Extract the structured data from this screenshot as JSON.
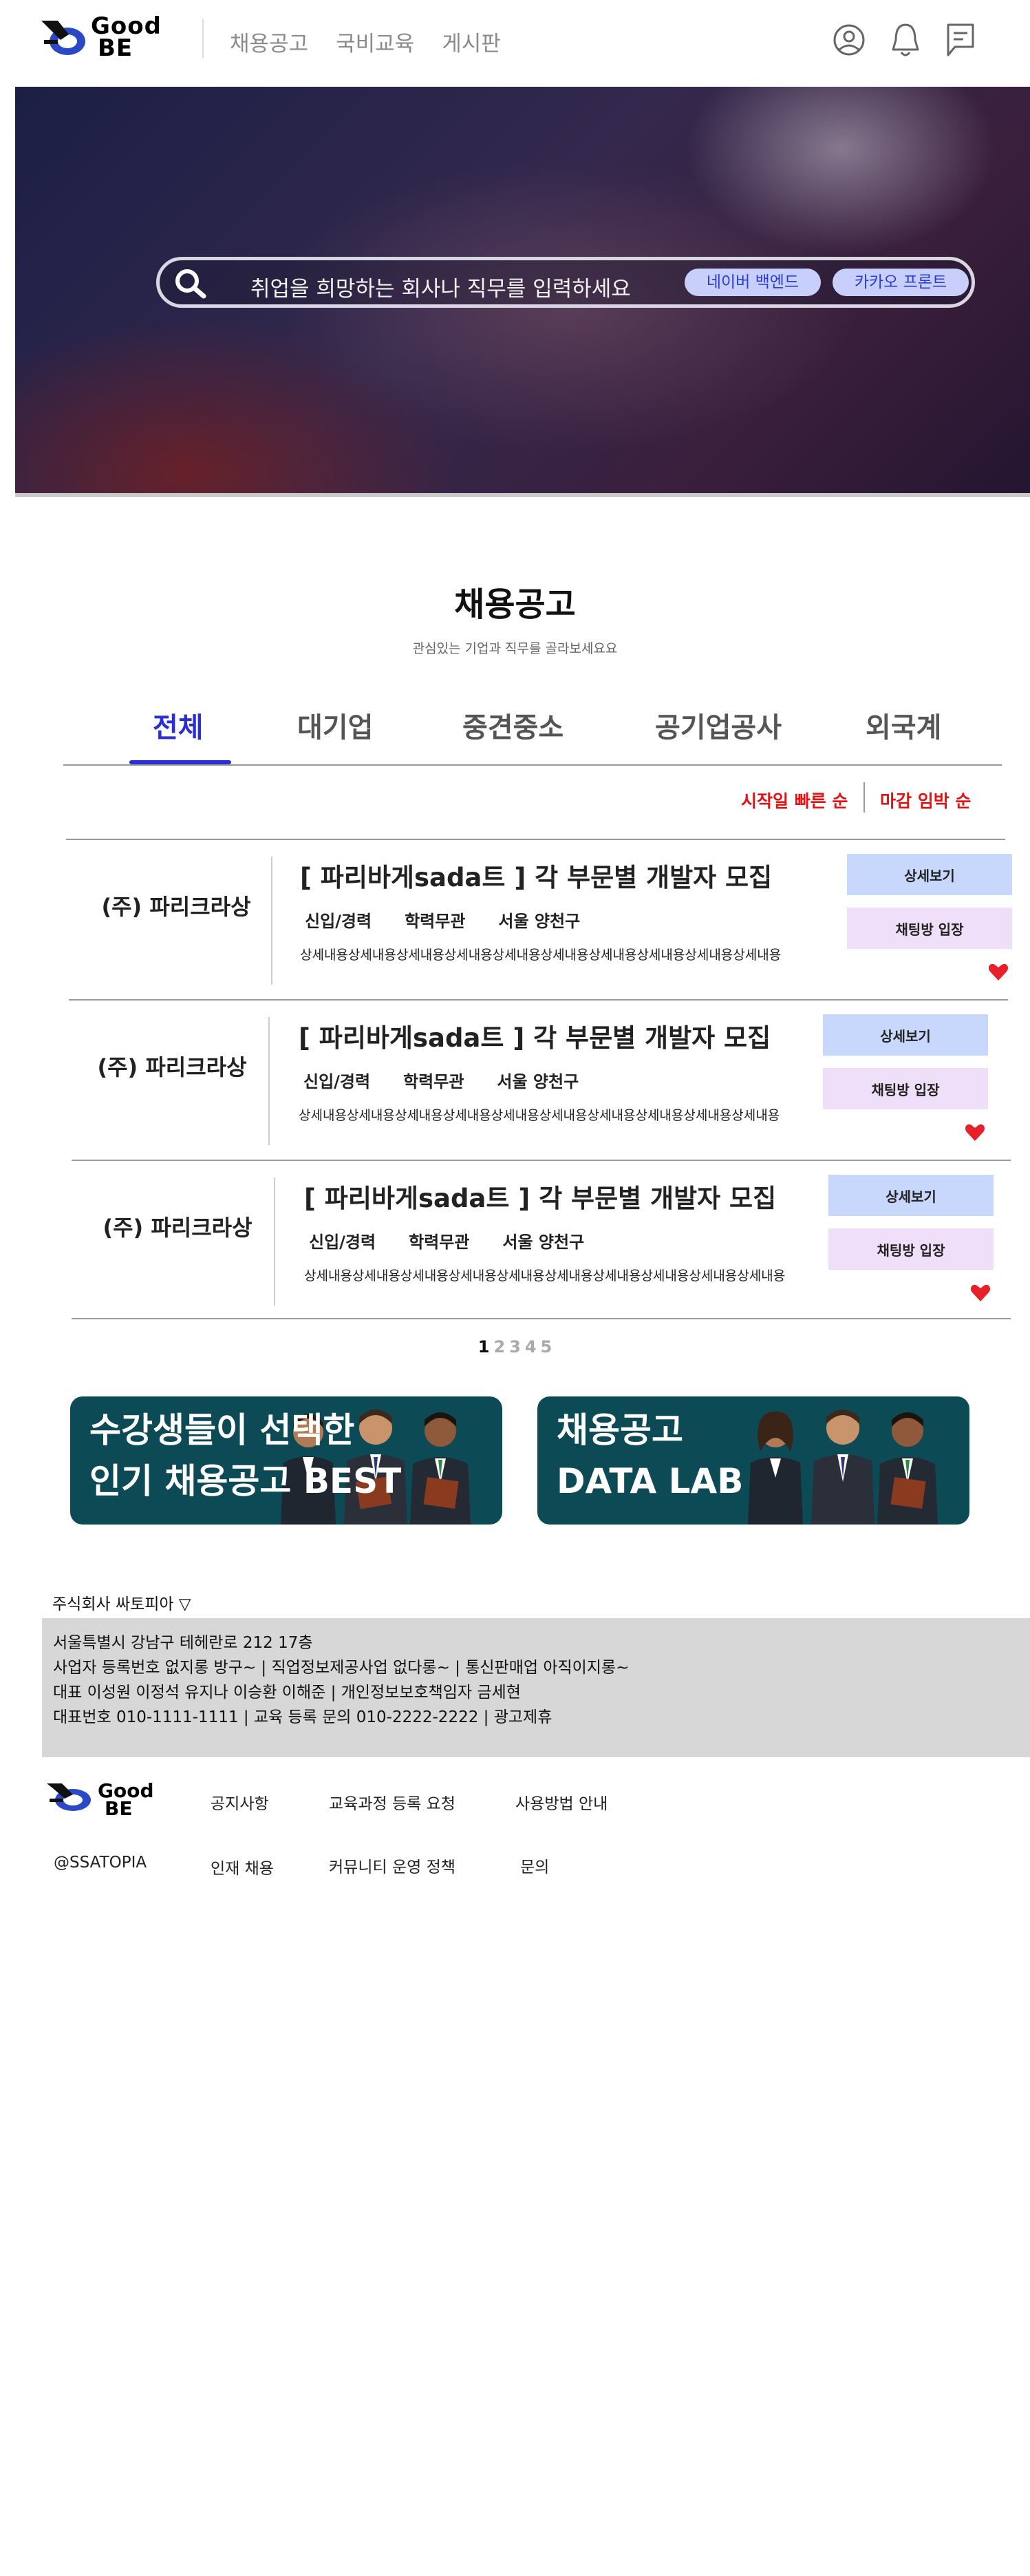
{
  "header": {
    "logo_text_line1": "Good",
    "logo_text_line2": "BE",
    "nav": [
      "채용공고",
      "국비교육",
      "게시판"
    ],
    "icons": [
      "profile-icon",
      "bell-icon",
      "message-icon"
    ]
  },
  "hero": {
    "search_placeholder": "취업을 희망하는 회사나 직무를 입력하세요",
    "chips": [
      "네이버 백엔드",
      "카카오 프론트"
    ]
  },
  "section": {
    "title": "채용공고",
    "subtitle": "관심있는 기업과 직무를 골라보세요요"
  },
  "tabs": [
    "전체",
    "대기업",
    "중견중소",
    "공기업공사",
    "외국계"
  ],
  "active_tab": "전체",
  "sort": {
    "option1": "시작일 빠른 순",
    "option2": "마감 임박 순"
  },
  "jobs": [
    {
      "company": "(주) 파리크라상",
      "title": "[ 파리바게sada트 ] 각 부문별 개발자 모집",
      "career": "신입/경력",
      "education": "학력무관",
      "location": "서울 양천구",
      "description": "상세내용상세내용상세내용상세내용상세내용상세내용상세내용상세내용상세내용상세내용",
      "detail_label": "상세보기",
      "chat_label": "채팅방 입장"
    },
    {
      "company": "(주) 파리크라상",
      "title": "[ 파리바게sada트 ] 각 부문별 개발자 모집",
      "career": "신입/경력",
      "education": "학력무관",
      "location": "서울 양천구",
      "description": "상세내용상세내용상세내용상세내용상세내용상세내용상세내용상세내용상세내용상세내용",
      "detail_label": "상세보기",
      "chat_label": "채팅방 입장"
    },
    {
      "company": "(주) 파리크라상",
      "title": "[ 파리바게sada트 ] 각 부문별 개발자 모집",
      "career": "신입/경력",
      "education": "학력무관",
      "location": "서울 양천구",
      "description": "상세내용상세내용상세내용상세내용상세내용상세내용상세내용상세내용상세내용상세내용",
      "detail_label": "상세보기",
      "chat_label": "채팅방 입장"
    }
  ],
  "pagination": [
    "1",
    "2",
    "3",
    "4",
    "5"
  ],
  "current_page": "1",
  "banners": [
    {
      "line1": "수강생들이 선택한",
      "line2": "인기 채용공고 BEST"
    },
    {
      "line1": "채용공고",
      "line2": "DATA LAB"
    }
  ],
  "footer": {
    "company_toggle": "주식회사 싸토피아 ▽",
    "info_lines": [
      "서울특별시 강남구 테헤란로 212 17층",
      "사업자 등록번호  없지롱 방구~ | 직업정보제공사업 없다롱~ | 통신판매업 아직이지롱~",
      "대표 이성원 이정석 유지나 이승환 이해준 | 개인정보보호책임자 금세현",
      "대표번호 010-1111-1111 | 교육 등록 문의 010-2222-2222 | 광고제휴"
    ],
    "handle": "@SSATOPIA",
    "links_row1": [
      "공지사항",
      "교육과정 등록 요청",
      "사용방법 안내"
    ],
    "links_row2": [
      "인재 채용",
      "커뮤니티 운영 정책",
      "문의"
    ]
  },
  "colors": {
    "accent": "#2b2fd3",
    "sort_red": "#e01414",
    "detail_button": "#c7d8fc",
    "chat_button": "#efdff9",
    "banner_bg": "#0c4a55"
  }
}
